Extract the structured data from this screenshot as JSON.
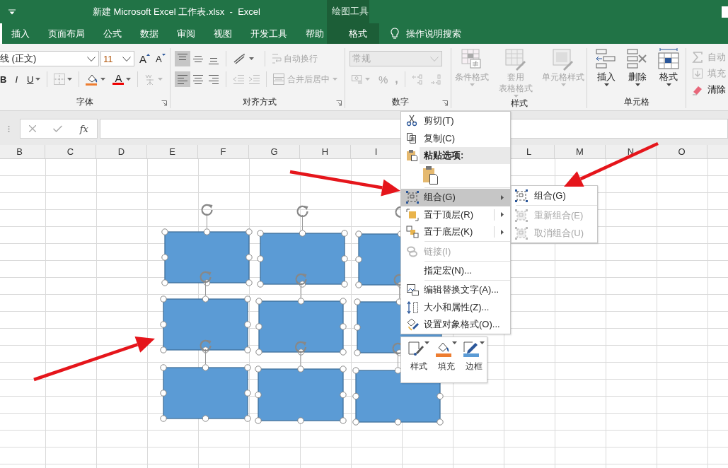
{
  "title_bar": {
    "title": "新建 Microsoft Excel 工作表.xlsx  -  Excel",
    "context_label": "绘图工具"
  },
  "tabs": [
    {
      "label": "插入",
      "selected": false,
      "kind": "main"
    },
    {
      "label": "页面布局",
      "selected": false,
      "kind": "main"
    },
    {
      "label": "公式",
      "selected": false,
      "kind": "main"
    },
    {
      "label": "数据",
      "selected": false,
      "kind": "main"
    },
    {
      "label": "审阅",
      "selected": false,
      "kind": "main"
    },
    {
      "label": "视图",
      "selected": false,
      "kind": "main"
    },
    {
      "label": "开发工具",
      "selected": false,
      "kind": "main"
    },
    {
      "label": "帮助",
      "selected": false,
      "kind": "main"
    },
    {
      "label": "格式",
      "selected": true,
      "kind": "context"
    }
  ],
  "tell_me": "操作说明搜索",
  "ribbon": {
    "font": {
      "label": "字体",
      "font_name": "线 (正文)",
      "font_size": "11",
      "grow_glyph": "A",
      "shrink_glyph": "A",
      "bold": "B",
      "italic": "I",
      "underline": "U",
      "font_color_glyph": "A",
      "phonetic_disabled": true
    },
    "alignment": {
      "label": "对齐方式",
      "vertical": [
        {
          "selected": true
        },
        {
          "selected": false
        },
        {
          "selected": false
        }
      ],
      "horizontal": [
        {
          "selected": true
        },
        {
          "selected": false
        },
        {
          "selected": false
        }
      ],
      "wrap": {
        "label": "自动换行",
        "disabled": true
      },
      "merge": {
        "label": "合并后居中",
        "disabled": true
      }
    },
    "number": {
      "label": "数字",
      "format": "常规",
      "percent": "%",
      "comma": ",",
      "disabled": true
    },
    "styles": {
      "label": "样式",
      "buttons": [
        {
          "lines": [
            "条件格式"
          ],
          "disabled": true
        },
        {
          "lines": [
            "套用",
            "表格格式"
          ],
          "disabled": true
        },
        {
          "lines": [
            "单元格样式"
          ],
          "disabled": true
        }
      ]
    },
    "cells": {
      "label": "单元格",
      "buttons": [
        {
          "label": "插入",
          "disabled": false
        },
        {
          "label": "删除",
          "disabled": false
        },
        {
          "label": "格式",
          "disabled": false
        }
      ]
    },
    "editing": {
      "items": [
        {
          "label": "自动",
          "disabled": true
        },
        {
          "label": "填充",
          "disabled": true
        },
        {
          "label": "清除",
          "disabled": false
        }
      ]
    }
  },
  "formula_bar": {
    "function_glyph": "fx"
  },
  "column_headers": [
    "B",
    "C",
    "D",
    "E",
    "F",
    "G",
    "H",
    "I",
    "L",
    "M",
    "N",
    "O"
  ],
  "shapes": [
    {
      "selected": true
    },
    {
      "selected": true
    },
    {
      "selected": true
    },
    {
      "selected": true
    },
    {
      "selected": true
    },
    {
      "selected": true
    },
    {
      "selected": true
    },
    {
      "selected": true
    },
    {
      "selected": true
    }
  ],
  "context_menu": {
    "items": [
      {
        "kind": "command",
        "label": "剪切(T)",
        "selected": false,
        "disabled": false
      },
      {
        "kind": "command",
        "label": "复制(C)",
        "selected": false,
        "disabled": false
      },
      {
        "kind": "heading",
        "label": "粘贴选项:"
      },
      {
        "kind": "paste_options"
      },
      {
        "kind": "separator"
      },
      {
        "kind": "command",
        "label": "组合(G)",
        "selected": true,
        "disabled": false,
        "submenu": true,
        "split": false
      },
      {
        "kind": "command",
        "label": "置于顶层(R)",
        "selected": false,
        "disabled": false,
        "submenu": true,
        "split": true
      },
      {
        "kind": "command",
        "label": "置于底层(K)",
        "selected": false,
        "disabled": false,
        "submenu": true,
        "split": true
      },
      {
        "kind": "separator"
      },
      {
        "kind": "command",
        "label": "链接(I)",
        "selected": false,
        "disabled": true
      },
      {
        "kind": "separator"
      },
      {
        "kind": "command",
        "label": "指定宏(N)...",
        "selected": false,
        "disabled": false
      },
      {
        "kind": "separator"
      },
      {
        "kind": "command",
        "label": "编辑替换文字(A)...",
        "selected": false,
        "disabled": false
      },
      {
        "kind": "command",
        "label": "大小和属性(Z)...",
        "selected": false,
        "disabled": false
      },
      {
        "kind": "command",
        "label": "设置对象格式(O)...",
        "selected": false,
        "disabled": false
      }
    ],
    "submenu": [
      {
        "kind": "command",
        "label": "组合(G)",
        "disabled": false
      },
      {
        "kind": "separator"
      },
      {
        "kind": "command",
        "label": "重新组合(E)",
        "disabled": true
      },
      {
        "kind": "command",
        "label": "取消组合(U)",
        "disabled": true
      }
    ]
  },
  "mini_toolbar": [
    {
      "label": "样式"
    },
    {
      "label": "填充"
    },
    {
      "label": "边框"
    }
  ]
}
